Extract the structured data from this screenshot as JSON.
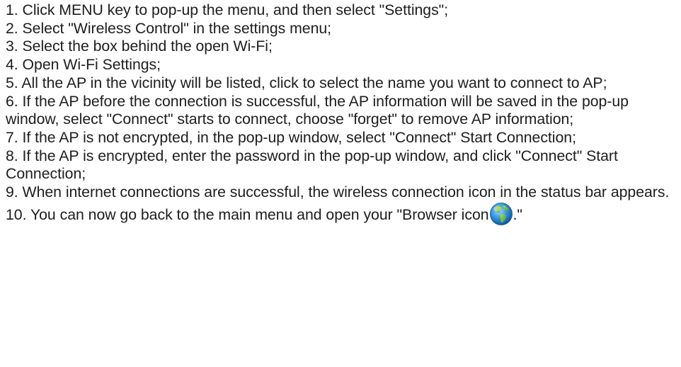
{
  "steps": [
    "1. Click MENU key to pop-up the menu, and then select \"Settings\";",
    "2. Select \"Wireless Control\" in the settings menu;",
    "3. Select the box behind the open Wi-Fi;",
    "4. Open Wi-Fi Settings;",
    "5. All the AP in the vicinity will be listed, click to select the name you want to connect to AP;",
    "6. If the AP before the connection is successful, the AP information will be saved in the pop-up window, select \"Connect\" starts to connect, choose \"forget\" to remove AP information;",
    "7. If the AP is not encrypted, in the pop-up window, select \"Connect\" Start Connection;",
    "8. If the AP is encrypted, enter the password in the pop-up window, and click \"Connect\" Start Connection;",
    "9. When internet connections are successful, the wireless connection icon in the status bar appears."
  ],
  "last_step": {
    "prefix": "10. You can now go back to the main menu and open your \"Browser icon",
    "suffix": ".\""
  },
  "icons": {
    "browser_icon": "globe-icon"
  },
  "colors": {
    "text": "#1d1d1d",
    "globe_ocean": "#2f8fd6",
    "globe_land": "#5cb83a"
  }
}
